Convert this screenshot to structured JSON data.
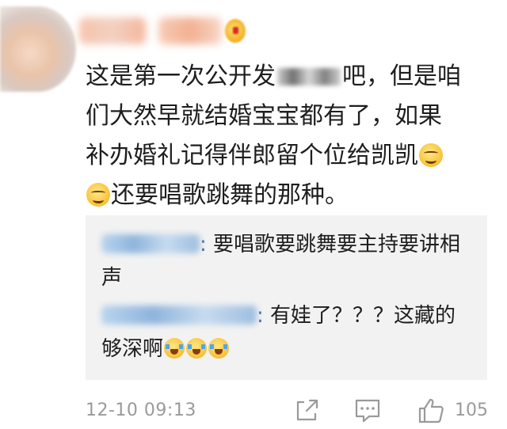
{
  "comment": {
    "line1_before": "这是第一次公开发",
    "line1_after": "吧，但是咱",
    "line2": "们大然早就结婚宝宝都有了，如果",
    "line3": "补办婚礼记得伴郎留个位给凯凯",
    "line4": "还要唱歌跳舞的那种。"
  },
  "replies": [
    {
      "colon": ":",
      "text": " 要唱歌要跳舞要主持要讲相声"
    },
    {
      "colon": ":",
      "text": " 有娃了？？？这藏的够深啊"
    }
  ],
  "footer": {
    "timestamp": "12-10 09:13",
    "like_count": "105"
  },
  "icons": {
    "share": "share-external-icon",
    "reply": "comment-bubble-icon",
    "like": "thumbs-up-icon",
    "emoji_smug": "smirk-emoji",
    "emoji_cry": "laugh-cry-emoji"
  }
}
